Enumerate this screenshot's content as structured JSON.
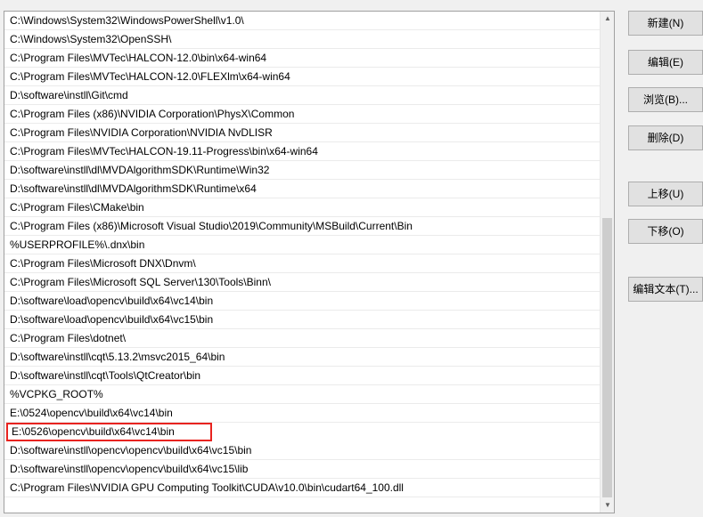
{
  "paths": [
    "C:\\Windows\\System32\\WindowsPowerShell\\v1.0\\",
    "C:\\Windows\\System32\\OpenSSH\\",
    "C:\\Program Files\\MVTec\\HALCON-12.0\\bin\\x64-win64",
    "C:\\Program Files\\MVTec\\HALCON-12.0\\FLEXlm\\x64-win64",
    "D:\\software\\instll\\Git\\cmd",
    "C:\\Program Files (x86)\\NVIDIA Corporation\\PhysX\\Common",
    "C:\\Program Files\\NVIDIA Corporation\\NVIDIA NvDLISR",
    "C:\\Program Files\\MVTec\\HALCON-19.11-Progress\\bin\\x64-win64",
    "D:\\software\\instll\\dl\\MVDAlgorithmSDK\\Runtime\\Win32",
    "D:\\software\\instll\\dl\\MVDAlgorithmSDK\\Runtime\\x64",
    "C:\\Program Files\\CMake\\bin",
    "C:\\Program Files (x86)\\Microsoft Visual Studio\\2019\\Community\\MSBuild\\Current\\Bin",
    "%USERPROFILE%\\.dnx\\bin",
    "C:\\Program Files\\Microsoft DNX\\Dnvm\\",
    "C:\\Program Files\\Microsoft SQL Server\\130\\Tools\\Binn\\",
    "D:\\software\\load\\opencv\\build\\x64\\vc14\\bin",
    "D:\\software\\load\\opencv\\build\\x64\\vc15\\bin",
    "C:\\Program Files\\dotnet\\",
    "D:\\software\\instll\\cqt\\5.13.2\\msvc2015_64\\bin",
    "D:\\software\\instll\\cqt\\Tools\\QtCreator\\bin",
    "%VCPKG_ROOT%",
    "E:\\0524\\opencv\\build\\x64\\vc14\\bin",
    "E:\\0526\\opencv\\build\\x64\\vc14\\bin",
    "D:\\software\\instll\\opencv\\opencv\\build\\x64\\vc15\\bin",
    "D:\\software\\instll\\opencv\\opencv\\build\\x64\\vc15\\lib",
    "C:\\Program Files\\NVIDIA GPU Computing Toolkit\\CUDA\\v10.0\\bin\\cudart64_100.dll"
  ],
  "highlighted_index": 22,
  "highlight_color": "#e8231f",
  "scrollbar": {
    "up_icon": "▲",
    "down_icon": "▼"
  },
  "buttons": {
    "new": "新建(N)",
    "edit": "编辑(E)",
    "browse": "浏览(B)...",
    "delete": "删除(D)",
    "move_up": "上移(U)",
    "move_down": "下移(O)",
    "edit_text": "编辑文本(T)..."
  }
}
